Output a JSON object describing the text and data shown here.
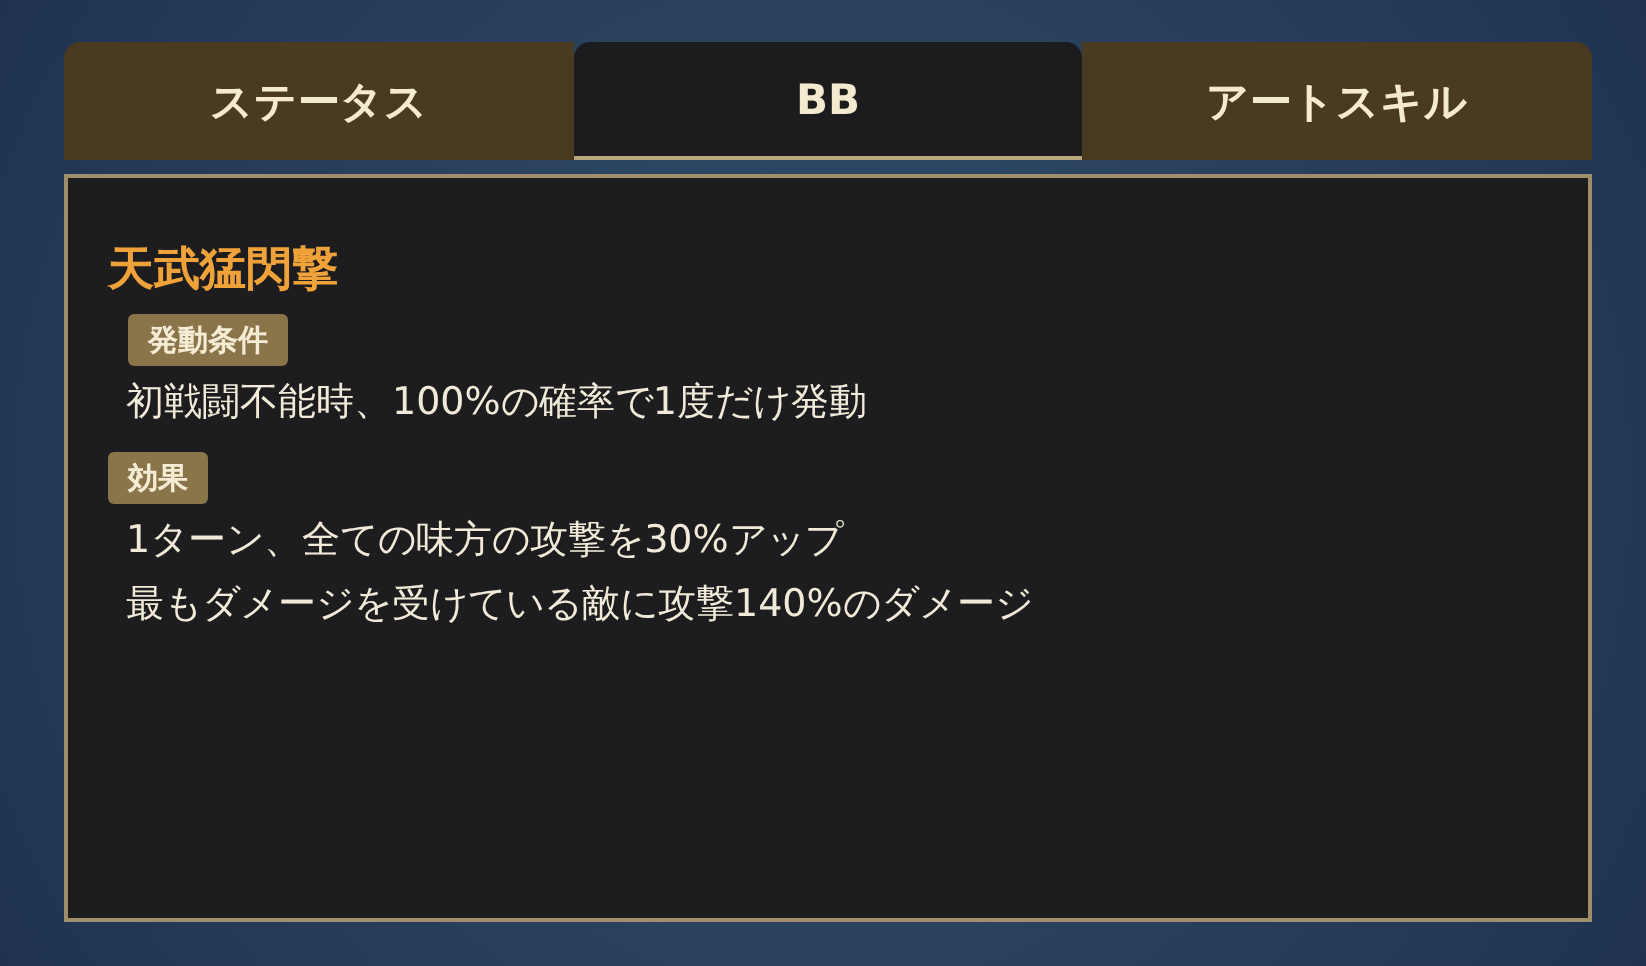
{
  "tabs": [
    {
      "label": "ステータス",
      "selected": false
    },
    {
      "label": "BB",
      "selected": true
    },
    {
      "label": "アートスキル",
      "selected": false
    }
  ],
  "skill": {
    "name": "天武猛閃撃",
    "sections": [
      {
        "label": "発動条件",
        "lines": [
          "初戦闘不能時、100%の確率で1度だけ発動"
        ]
      },
      {
        "label": "効果",
        "lines": [
          "1ターン、全ての味方の攻撃を30%アップ",
          "最もダメージを受けている敵に攻撃140%のダメージ"
        ]
      }
    ]
  }
}
